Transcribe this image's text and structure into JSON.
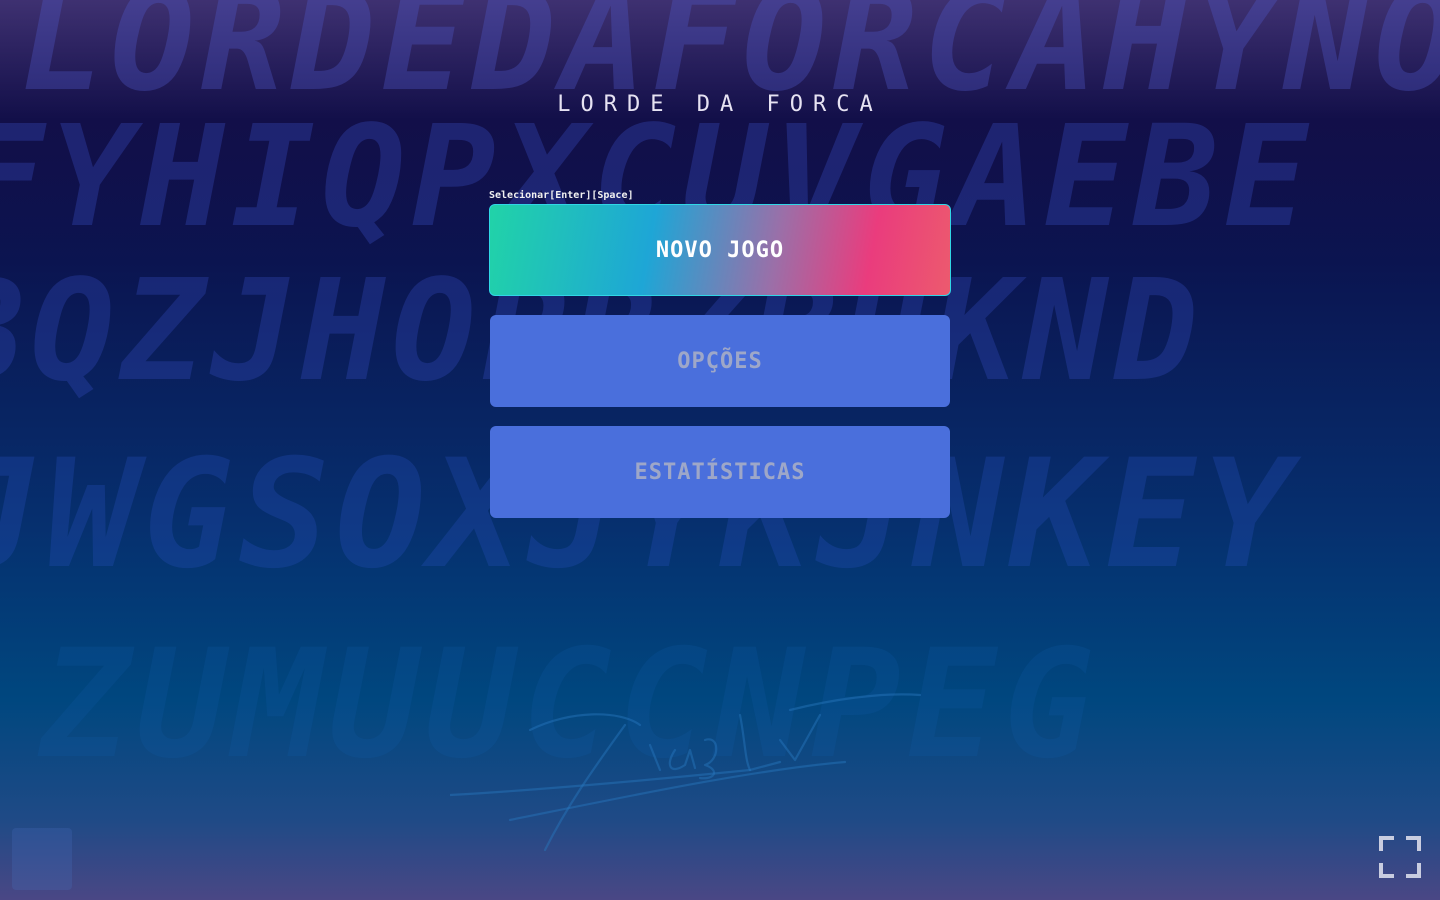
{
  "app": {
    "title": "LORDE DA FORCA"
  },
  "hint": {
    "text": "Selecionar[Enter][Space]"
  },
  "menu": {
    "new_game_label": "NOVO JOGO",
    "options_label": "OPÇÕES",
    "stats_label": "ESTATÍSTICAS"
  },
  "background": {
    "letter_rows": [
      "LORDEDAFORCAHYNO",
      "FYHIQPXCUVGAEBE",
      "BQZJHOPRZBHKND",
      "JWGSOXJYKJNKEY",
      "ZUMUUCCNPEG"
    ]
  },
  "icons": {
    "fullscreen": "fullscreen-icon"
  },
  "colors": {
    "button_plain": "#4a6fdc",
    "button_text_plain": "#9ea7c8",
    "gradient_start": "#21d3a8",
    "gradient_end": "#ea3c7d"
  }
}
